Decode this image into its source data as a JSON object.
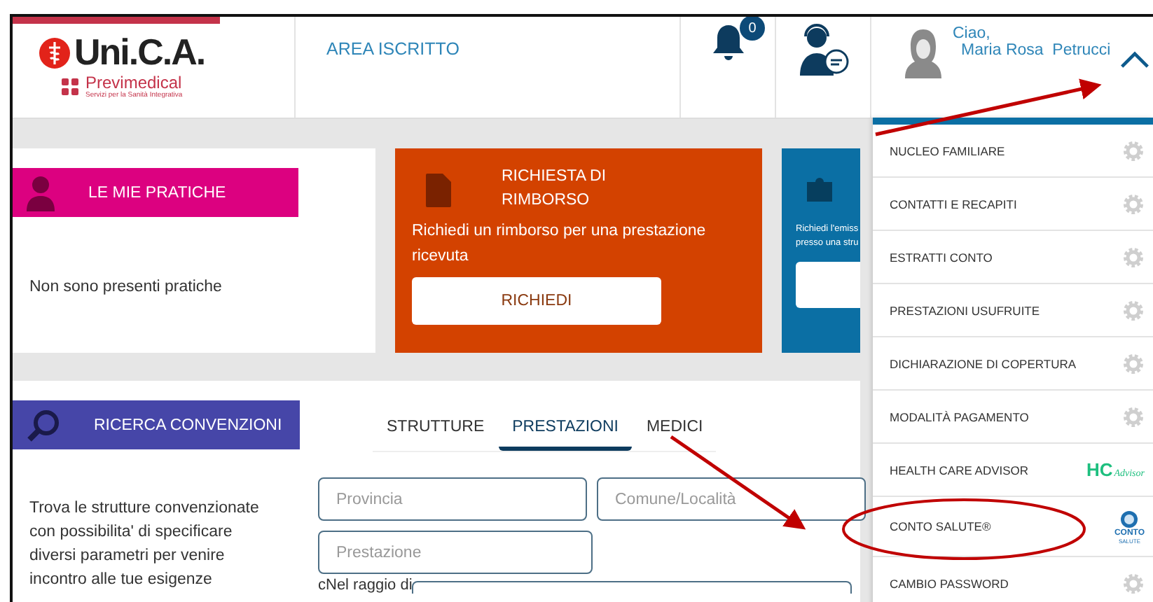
{
  "header": {
    "logo": {
      "name": "Uni.C.A.",
      "partner": "Previmedical",
      "tagline": "Servizi per la Sanità Integrativa"
    },
    "area_link": "AREA ISCRITTO",
    "notifications": {
      "badge": "0"
    },
    "user": {
      "greeting": "Ciao,",
      "first_name": "Maria Rosa",
      "last_name": "Petrucci",
      "menu_expanded": true
    }
  },
  "cards": [
    {
      "kind": "pratiche",
      "title": "LE MIE PRATICHE",
      "text": "Non sono presenti pratiche"
    },
    {
      "kind": "rimborso",
      "title": "RICHIESTA DI RIMBORSO",
      "text": "Richiedi un rimborso per una prestazione ricevuta",
      "button": "RICHIEDI"
    },
    {
      "kind": "presa-in-carico",
      "lines": [
        "Richiedi l'emiss",
        "presso una stru"
      ]
    }
  ],
  "search": {
    "title": "RICERCA CONVENZIONI",
    "description": "Trova le strutture convenzionate con possibilita' di specificare diversi parametri per venire incontro alle tue esigenze",
    "tabs": [
      {
        "label": "STRUTTURE",
        "selected": false
      },
      {
        "label": "PRESTAZIONI",
        "selected": true
      },
      {
        "label": "MEDICI",
        "selected": false
      }
    ],
    "fields": [
      {
        "placeholder": "Provincia"
      },
      {
        "placeholder": "Comune/Località"
      },
      {
        "placeholder": "Prestazione"
      }
    ],
    "radius_label": "cNel raggio di"
  },
  "menu": {
    "items": [
      {
        "label": "NUCLEO FAMILIARE",
        "kind": "gear"
      },
      {
        "label": "CONTATTI E RECAPITI",
        "kind": "gear"
      },
      {
        "label": "ESTRATTI CONTO",
        "kind": "gear"
      },
      {
        "label": "PRESTAZIONI USUFRUITE",
        "kind": "gear"
      },
      {
        "label": "DICHIARAZIONE DI COPERTURA",
        "kind": "gear"
      },
      {
        "label": "MODALITÀ PAGAMENTO",
        "kind": "gear"
      },
      {
        "label": "HEALTH CARE ADVISOR",
        "kind": "hc-logo",
        "logo_text": [
          "HC",
          "Advisor"
        ]
      },
      {
        "label": "CONTO SALUTE®",
        "kind": "conto-logo",
        "logo_text": [
          "CONTO",
          "SALUTE"
        ]
      },
      {
        "label": "CAMBIO PASSWORD",
        "kind": "gear"
      }
    ]
  }
}
